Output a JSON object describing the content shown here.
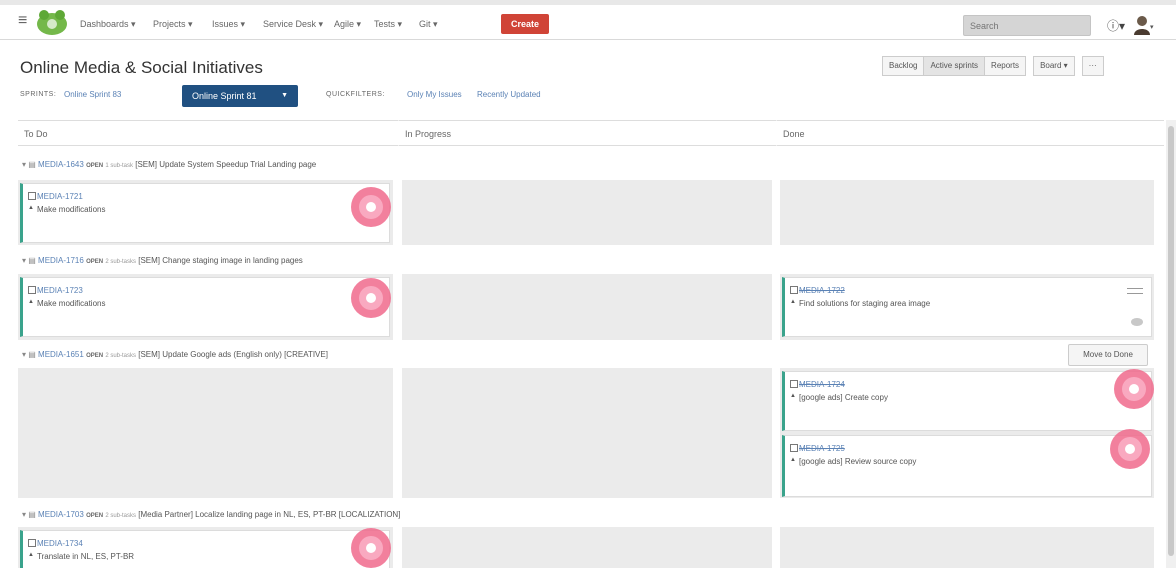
{
  "nav": {
    "items": [
      "Dashboards ▾",
      "Projects ▾",
      "Issues ▾",
      "Service Desk ▾",
      "Agile ▾",
      "Tests ▾",
      "Git ▾"
    ],
    "create_label": "Create",
    "search_placeholder": "Search",
    "help_icon": "help-icon",
    "user_icon": "user-avatar-icon",
    "menu_icon": "app-switcher-icon",
    "logo_icon": "logo-icon"
  },
  "header": {
    "title": "Online Media & Social Initiatives",
    "buttons": [
      "Backlog",
      "Active sprints",
      "Reports"
    ],
    "board_button": "Board ▾",
    "more_button": "···"
  },
  "filters": {
    "sprints_label": "SPRINTS:",
    "sprint_link": "Online Sprint 83",
    "sprint_selected": "Online Sprint 81",
    "quickfilters_label": "QUICKFILTERS:",
    "quickfilter_1": "Only My Issues",
    "quickfilter_2": "Recently Updated"
  },
  "columns": [
    "To Do",
    "In Progress",
    "Done"
  ],
  "swimlanes": [
    {
      "key": "MEDIA-1643",
      "status": "OPEN",
      "subtasks": "1 sub-task",
      "title": "[SEM] Update System Speedup Trial Landing page",
      "todo": [
        {
          "key": "MEDIA-1721",
          "summary": "Make modifications"
        }
      ],
      "done": []
    },
    {
      "key": "MEDIA-1716",
      "status": "OPEN",
      "subtasks": "2 sub-tasks",
      "title": "[SEM] Change staging image in landing pages",
      "todo": [
        {
          "key": "MEDIA-1723",
          "summary": "Make modifications"
        }
      ],
      "done": [
        {
          "key": "MEDIA-1722",
          "summary": "Find solutions for staging area image"
        }
      ]
    },
    {
      "key": "MEDIA-1651",
      "status": "OPEN",
      "subtasks": "2 sub-tasks",
      "title": "[SEM] Update Google ads (English only) [CREATIVE]",
      "move_button": "Move to Done",
      "todo": [],
      "done": [
        {
          "key": "MEDIA-1724",
          "summary": "[google ads] Create copy"
        },
        {
          "key": "MEDIA-1725",
          "summary": "[google ads] Review source copy"
        }
      ]
    },
    {
      "key": "MEDIA-1703",
      "status": "OPEN",
      "subtasks": "2 sub-tasks",
      "title": "[Media Partner] Localize landing page in NL, ES, PT-BR [LOCALIZATION]",
      "todo": [
        {
          "key": "MEDIA-1734",
          "summary": "Translate in NL, ES, PT-BR"
        }
      ],
      "done": []
    }
  ],
  "colors": {
    "accent": "#205081",
    "create": "#d04437",
    "card_border": "#3aa38c",
    "link": "#5b82b5"
  }
}
